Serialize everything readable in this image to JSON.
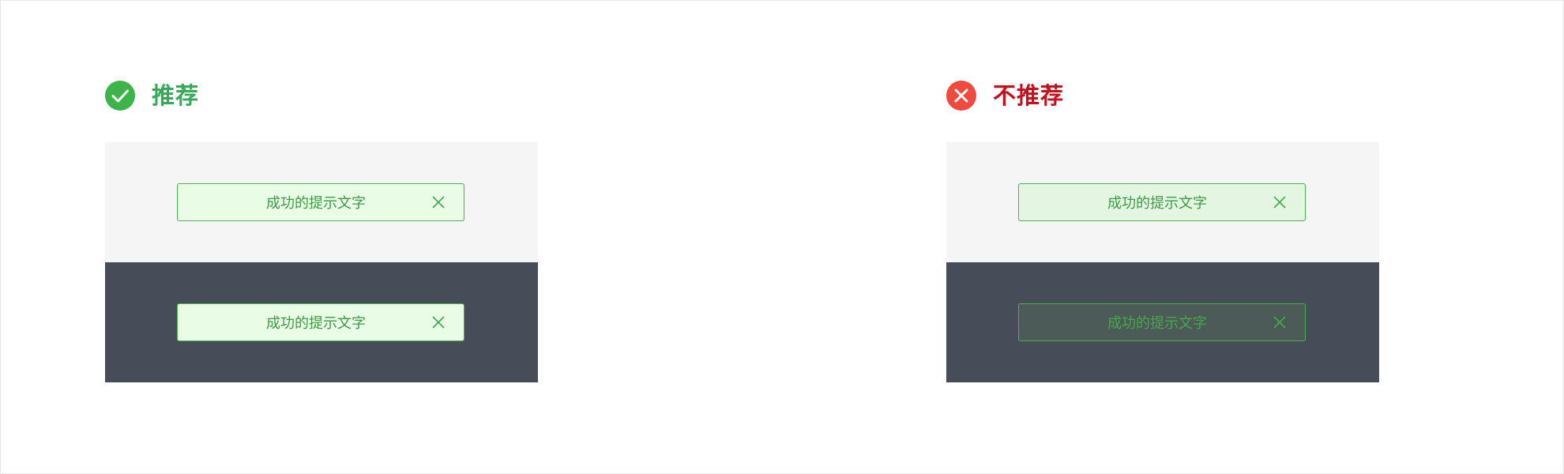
{
  "recommended": {
    "title": "推荐",
    "icon": "check-circle-icon",
    "title_color": "#3aa85a",
    "icon_color": "#3cb44a",
    "light_toast": {
      "text": "成功的提示文字",
      "background": "#e8fce6",
      "text_color": "#3e9a45"
    },
    "dark_toast": {
      "text": "成功的提示文字",
      "background": "#e8fce6",
      "text_color": "#3e9a45"
    }
  },
  "not_recommended": {
    "title": "不推荐",
    "icon": "close-circle-icon",
    "title_color": "#c4101c",
    "icon_color": "#f04a3f",
    "light_toast": {
      "text": "成功的提示文字",
      "background": "#e4f6e2",
      "text_color": "#3e9a45"
    },
    "dark_toast": {
      "text": "成功的提示文字",
      "background": "#4c5b58",
      "text_color": "#45a94b"
    }
  },
  "colors": {
    "light_bg": "#f5f5f5",
    "dark_bg": "#474c59",
    "toast_border": "#4bb152"
  }
}
